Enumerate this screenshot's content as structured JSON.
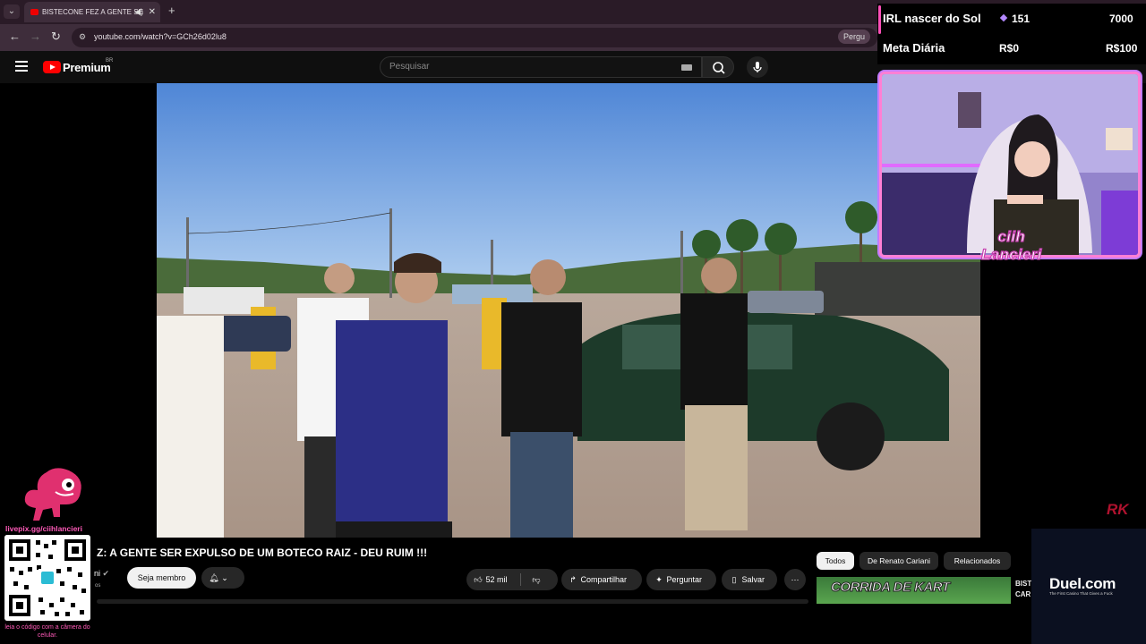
{
  "browser": {
    "tab_title": "BISTECONE FEZ A GENTE SE",
    "address": "youtube.com/watch?v=GCh26d02lu8",
    "ask_chip": "Pergu",
    "new_tab_icon": "plus-icon",
    "tab_list_icon": "chevron-down-icon"
  },
  "youtube": {
    "brand": "Premium",
    "brand_region": "BR",
    "search_placeholder": "Pesquisar",
    "video_title": "A GENTE SER EXPULSO DE UM BOTECO RAIZ - DEU RUIM !!!",
    "title_prefix": "Z",
    "channel_fragment": "ni",
    "channel_sub": "os",
    "member_button": "Seja membro",
    "like_count": "52 mil",
    "share_label": "Compartilhar",
    "ask_label": "Perguntar",
    "save_label": "Salvar",
    "chips": [
      "Todos",
      "De Renato Cariani",
      "Relacionados"
    ],
    "thumb_text": "CORRIDA DE KART",
    "side_title_lines": [
      "BIST",
      "CAR"
    ]
  },
  "stream_overlay": {
    "goal_label": "IRL nascer do Sol",
    "goal_count": "151",
    "goal_target": "7000",
    "daily_label": "Meta Diária",
    "daily_current": "R$0",
    "daily_target": "R$100",
    "cam_name_line1": "ciih",
    "cam_name_line2": "Lancieri",
    "corner_logo": "RK",
    "sponsor_title": "Duel.com",
    "sponsor_sub": "The First Casino That Gives a Fuck",
    "livepix_url": "livepix.gg/ciihlancieri",
    "qr_caption": "leia o código com a câmera do celular."
  },
  "colors": {
    "accent_pink": "#ff5ab8",
    "youtube_red": "#ff0000",
    "cam_border": "#ff7fd4"
  }
}
